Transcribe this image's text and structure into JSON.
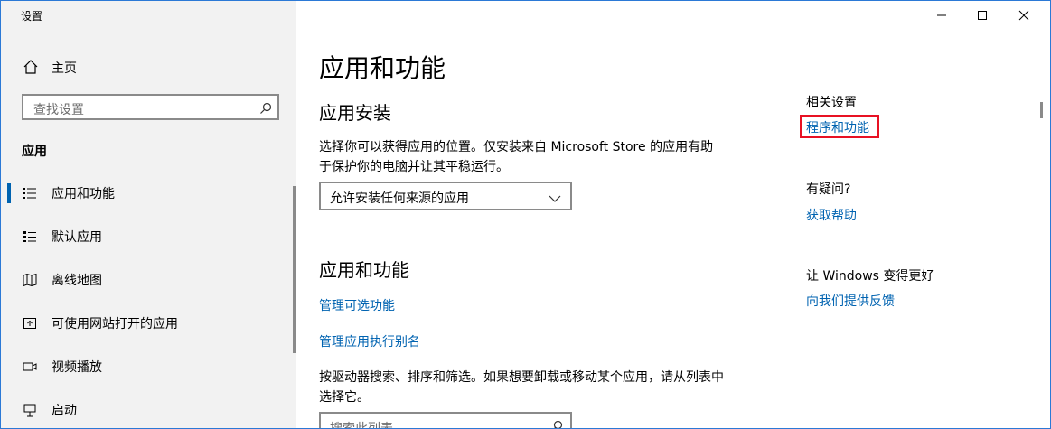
{
  "window": {
    "title": "设置"
  },
  "sidebar": {
    "home_label": "主页",
    "search_placeholder": "查找设置",
    "section_label": "应用",
    "items": [
      {
        "label": "应用和功能",
        "icon": "apps-features-icon",
        "active": true
      },
      {
        "label": "默认应用",
        "icon": "default-apps-icon"
      },
      {
        "label": "离线地图",
        "icon": "offline-maps-icon"
      },
      {
        "label": "可使用网站打开的应用",
        "icon": "apps-for-websites-icon"
      },
      {
        "label": "视频播放",
        "icon": "video-playback-icon"
      },
      {
        "label": "启动",
        "icon": "startup-icon"
      }
    ]
  },
  "main": {
    "title": "应用和功能",
    "install": {
      "heading": "应用安装",
      "description": "选择你可以获得应用的位置。仅安装来自 Microsoft Store 的应用有助于保护你的电脑并让其平稳运行。",
      "dropdown_value": "允许安装任何来源的应用"
    },
    "apps": {
      "heading": "应用和功能",
      "link_optional": "管理可选功能",
      "link_alias": "管理应用执行别名",
      "description": "按驱动器搜索、排序和筛选。如果想要卸载或移动某个应用，请从列表中选择它。",
      "search_placeholder": "搜索此列表"
    }
  },
  "related": {
    "heading": "相关设置",
    "programs_link": "程序和功能",
    "question_heading": "有疑问?",
    "help_link": "获取帮助",
    "improve_heading": "让 Windows 变得更好",
    "feedback_link": "向我们提供反馈"
  },
  "colors": {
    "accent": "#0063b1",
    "highlight": "#e81123",
    "sidebar_bg": "#f2f2f2"
  }
}
